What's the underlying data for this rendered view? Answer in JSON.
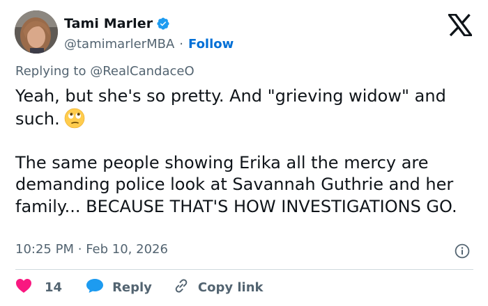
{
  "author": {
    "display_name": "Tami Marler",
    "handle": "@tamimarlerMBA",
    "separator": "·",
    "follow_label": "Follow",
    "verified": true,
    "avatar_icon": "profile-photo"
  },
  "brand": {
    "logo_icon": "x-logo-icon"
  },
  "reply_context": {
    "prefix": "Replying to",
    "mention": "@RealCandaceO"
  },
  "tweet": {
    "paragraph_1": "Yeah, but she's so pretty. And \"grieving widow\" and such.",
    "paragraph_1_emoji": "face-with-rolling-eyes-emoji",
    "paragraph_2": "The same people showing Erika all the mercy are demanding police look at Savannah Guthrie and her family... BECAUSE THAT'S HOW INVESTIGATIONS GO."
  },
  "meta": {
    "time": "10:25 PM",
    "separator": "·",
    "date": "Feb 10, 2026",
    "info_icon": "info-icon"
  },
  "actions": {
    "like_count": "14",
    "reply_label": "Reply",
    "copy_link_label": "Copy link"
  },
  "colors": {
    "text_primary": "#0f1419",
    "text_secondary": "#536471",
    "link_blue": "#006fd6",
    "verified_blue": "#1d9bf0",
    "heart_pink": "#f91880",
    "divider": "#cfd9de"
  }
}
